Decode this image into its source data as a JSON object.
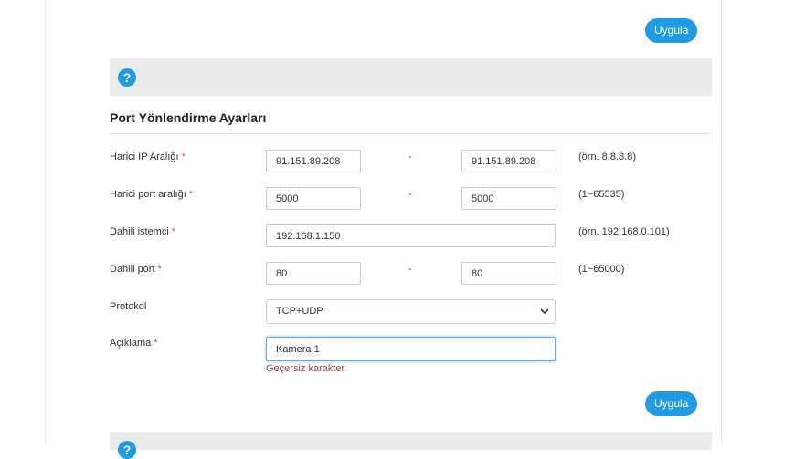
{
  "buttons": {
    "apply_label": "Uygula"
  },
  "help": {
    "icon_glyph": "?"
  },
  "section": {
    "title": "Port Yönlendirme Ayarları"
  },
  "form": {
    "required_mark": "*",
    "range_separator": "-",
    "external_ip": {
      "label": "Harici IP Aralığı",
      "start": "91.151.89.208",
      "end": "91.151.89.208",
      "hint": "(örn. 8.8.8.8)"
    },
    "external_port": {
      "label": "Harici port aralığı",
      "start": "5000",
      "end": "5000",
      "hint": "(1~65535)"
    },
    "internal_client": {
      "label": "Dahili istemci",
      "value": "192.168.1.150",
      "hint": "(örn. 192.168.0.101)"
    },
    "internal_port": {
      "label": "Dahili port",
      "start": "80",
      "end": "80",
      "hint": "(1~65000)"
    },
    "protocol": {
      "label": "Protokol",
      "selected": "TCP+UDP"
    },
    "description": {
      "label": "Açıklama",
      "value": "Kamera 1",
      "error": "Geçersiz karakter"
    }
  },
  "colors": {
    "accent": "#1e9be3",
    "error": "#a94442",
    "required": "#d9534f",
    "help_bar_bg": "#ebebeb"
  }
}
